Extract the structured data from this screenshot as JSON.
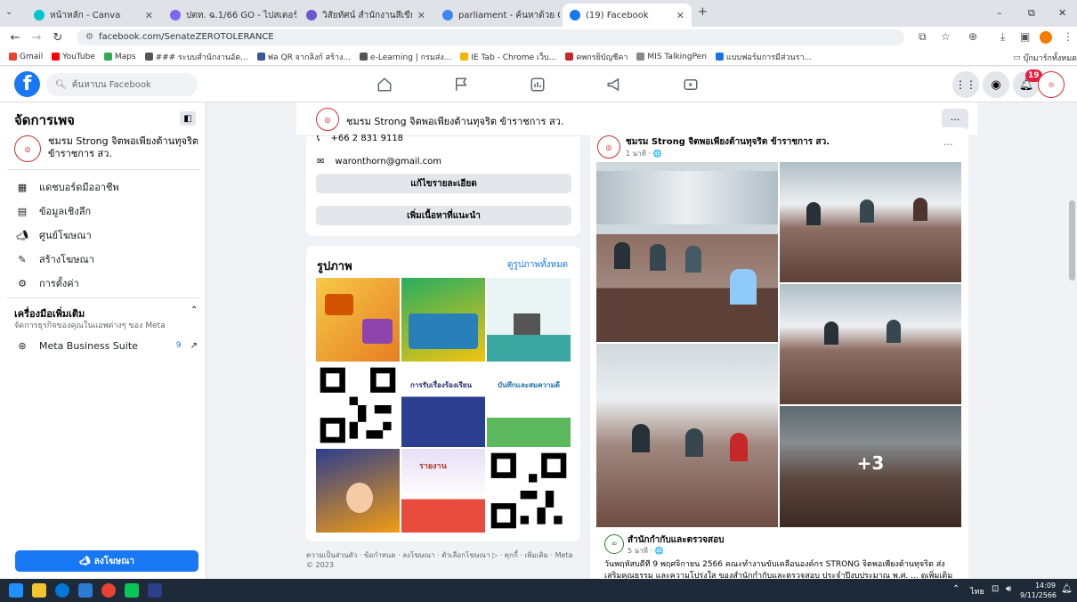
{
  "browser": {
    "tabs": [
      {
        "title": "หน้าหลัก - Canva",
        "color": "#00c4cc"
      },
      {
        "title": "ปตท. ฉ.1/66 GO - ไปสเตอร์",
        "color": "#7b68ee"
      },
      {
        "title": "วิสัยทัศน์ สำนักงานสีเขียว \"มุ่งมั่น ม...",
        "color": "#6a5acd"
      },
      {
        "title": "parliament - ค้นหาด้วย Google",
        "color": "#4285f4"
      },
      {
        "title": "(19) Facebook",
        "color": "#1877f2"
      }
    ],
    "new_tab": "+",
    "window_controls": [
      "–",
      "⧉",
      "✕"
    ],
    "url": "facebook.com/SenateZEROTOLERANCE",
    "bookmarks": [
      {
        "label": "Gmail",
        "color": "#ea4335"
      },
      {
        "label": "YouTube",
        "color": "#ff0000"
      },
      {
        "label": "Maps",
        "color": "#34a853"
      },
      {
        "label": "### ระบบสำนักงานอัต...",
        "color": "#555555"
      },
      {
        "label": "ฟล QR จากลิงก์ สร้าง...",
        "color": "#3b5998"
      },
      {
        "label": "e-Learning | กรมส่ง...",
        "color": "#555555"
      },
      {
        "label": "IE Tab - Chrome เว็บ...",
        "color": "#f4b400"
      },
      {
        "label": "คพกรยิบัญชีคา",
        "color": "#c62828"
      },
      {
        "label": "MIS TalkingPen",
        "color": "#888888"
      },
      {
        "label": "แบบฟอร์มการมีส่วนรา...",
        "color": "#1a73e8"
      }
    ],
    "all_bookmarks": "บุ๊กมาร์กทั้งหมด"
  },
  "fb_header": {
    "logo": "f",
    "search_placeholder": "ค้นหาบน Facebook",
    "notification_count": "19"
  },
  "sidebar": {
    "title": "จัดการเพจ",
    "page_name": "ชมรม Strong จิตพอเพียงต้านทุจริต ข้าราชการ สว.",
    "items": [
      {
        "label": "แดชบอร์ดมืออาชีพ",
        "icon": "dashboard-icon"
      },
      {
        "label": "ข้อมูลเชิงลึก",
        "icon": "insights-icon"
      },
      {
        "label": "ศูนย์โฆษณา",
        "icon": "megaphone-icon"
      },
      {
        "label": "สร้างโฆษณา",
        "icon": "edit-icon"
      },
      {
        "label": "การตั้งค่า",
        "icon": "gear-icon"
      }
    ],
    "tools_title": "เครื่องมือเพิ่มเติม",
    "tools_subtitle": "จัดการธุรกิจของคุณในแอพต่างๆ ของ Meta",
    "meta_suite": "Meta Business Suite",
    "meta_suite_count": "9",
    "promote_button": "ลงโฆษณา"
  },
  "page_header": {
    "name": "ชมรม Strong จิตพอเพียงต้านทุจริต ข้าราชการ สว.",
    "more": "···"
  },
  "about": {
    "phone": "+66 2 831 9118",
    "email": "waronthorn@gmail.com",
    "edit_button": "แก้ไขรายละเอียด",
    "featured_button": "เพิ่มเนื้อหาที่แนะนำ"
  },
  "photos": {
    "title": "รูปภาพ",
    "see_all": "ดูรูปภาพทั้งหมด",
    "thumb_texts": [
      "การรับเรื่องร้องเรียน",
      "บันทึกและสมความดี",
      "รายงาน"
    ]
  },
  "footer_text": "ความเป็นส่วนตัว · ข้อกำหนด · ลงโฆษณา · ตัวเลือกโฆษณา ▷ · คุกกี้ · เพิ่มเติม · Meta © 2023",
  "post": {
    "author": "ชมรม Strong จิตพอเพียงต้านทุจริต ข้าราชการ สว.",
    "time": "1 นาที · 🌐",
    "more": "···",
    "extra_photos": "+3",
    "shared_from": "สำนักกำกับและตรวจสอบ",
    "shared_time": "5 นาที · 🌐",
    "body": "วันพฤหัสบดีที่ 9 พฤศจิกายน 2566 คณะทำงานขับเคลื่อนองค์กร STRONG จิตพอเพียงต้านทุจริต ส่งเสริมคุณธรรม และความโปร่งใส ของสำนักกำกับและตรวจสอบ ประจำปีงบประมาณ พ.ศ. ... ดูเพิ่มเติม"
  },
  "taskbar": {
    "lang": "ไทย",
    "time": "14:09",
    "date": "9/11/2566"
  }
}
